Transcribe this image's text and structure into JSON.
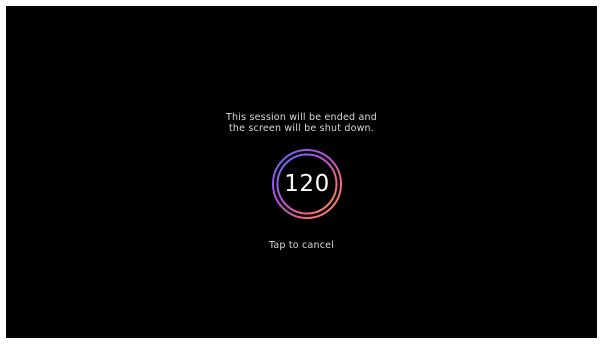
{
  "dialog": {
    "message_line1": "This session will be ended and",
    "message_line2": "the screen will be shut down.",
    "countdown": "120",
    "cancel_label": "Tap to cancel"
  },
  "colors": {
    "background": "#000000",
    "text": "#d8d8d8",
    "ring_gradient": [
      "#5b6cf0",
      "#b34fe0",
      "#f06a7a",
      "#f0a040"
    ]
  }
}
